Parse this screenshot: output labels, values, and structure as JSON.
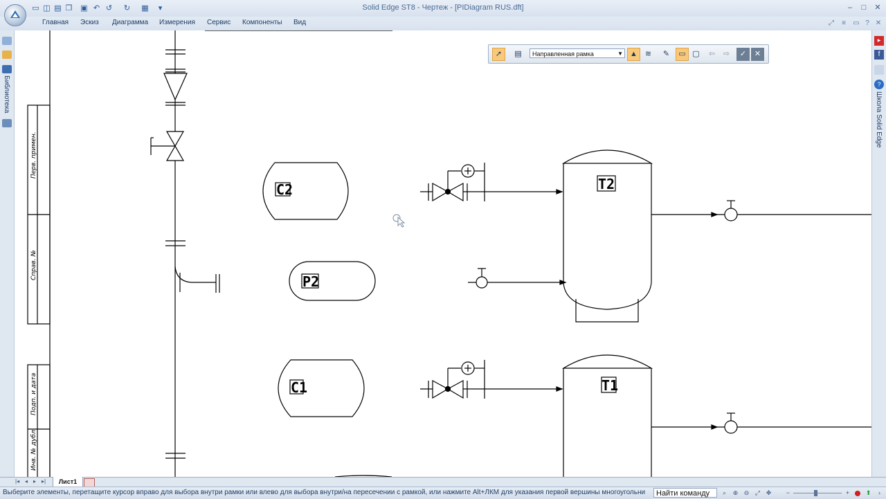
{
  "window": {
    "title": "Solid Edge ST8 - Чертеж - [PIDiagram RUS.dft]",
    "controls": [
      "–",
      "□",
      "✕"
    ]
  },
  "menu": {
    "items": [
      "Главная",
      "Эскиз",
      "Диаграмма",
      "Измерения",
      "Сервис",
      "Компоненты",
      "Вид"
    ],
    "right_icons": [
      "pin-icon",
      "options-icon",
      "minimize-ribbon-icon",
      "help-icon",
      "close-doc-icon"
    ]
  },
  "left_dock": {
    "library_label": "Библиотека"
  },
  "right_dock": {
    "school_label": "Школа Solid Edge"
  },
  "floating_toolbar": {
    "selection_mode": "Направленная рамка"
  },
  "drawing": {
    "stamp_labels": [
      "Перв. примен.",
      "Справ. №",
      "Подп. и дата",
      "Инв. № дубл."
    ],
    "tags": [
      "C2",
      "P2",
      "C1",
      "T2",
      "T1"
    ]
  },
  "sheet_tabs": {
    "active": "Лист1"
  },
  "status": {
    "prompt": "Выберите элементы, перетащите курсор вправо для выбора внутри рамки или влево для выбора внутри/на пересечении с рамкой, или нажмите Alt+ЛКМ для указания первой вершины многоугольни",
    "find_command": "Найти команду"
  }
}
